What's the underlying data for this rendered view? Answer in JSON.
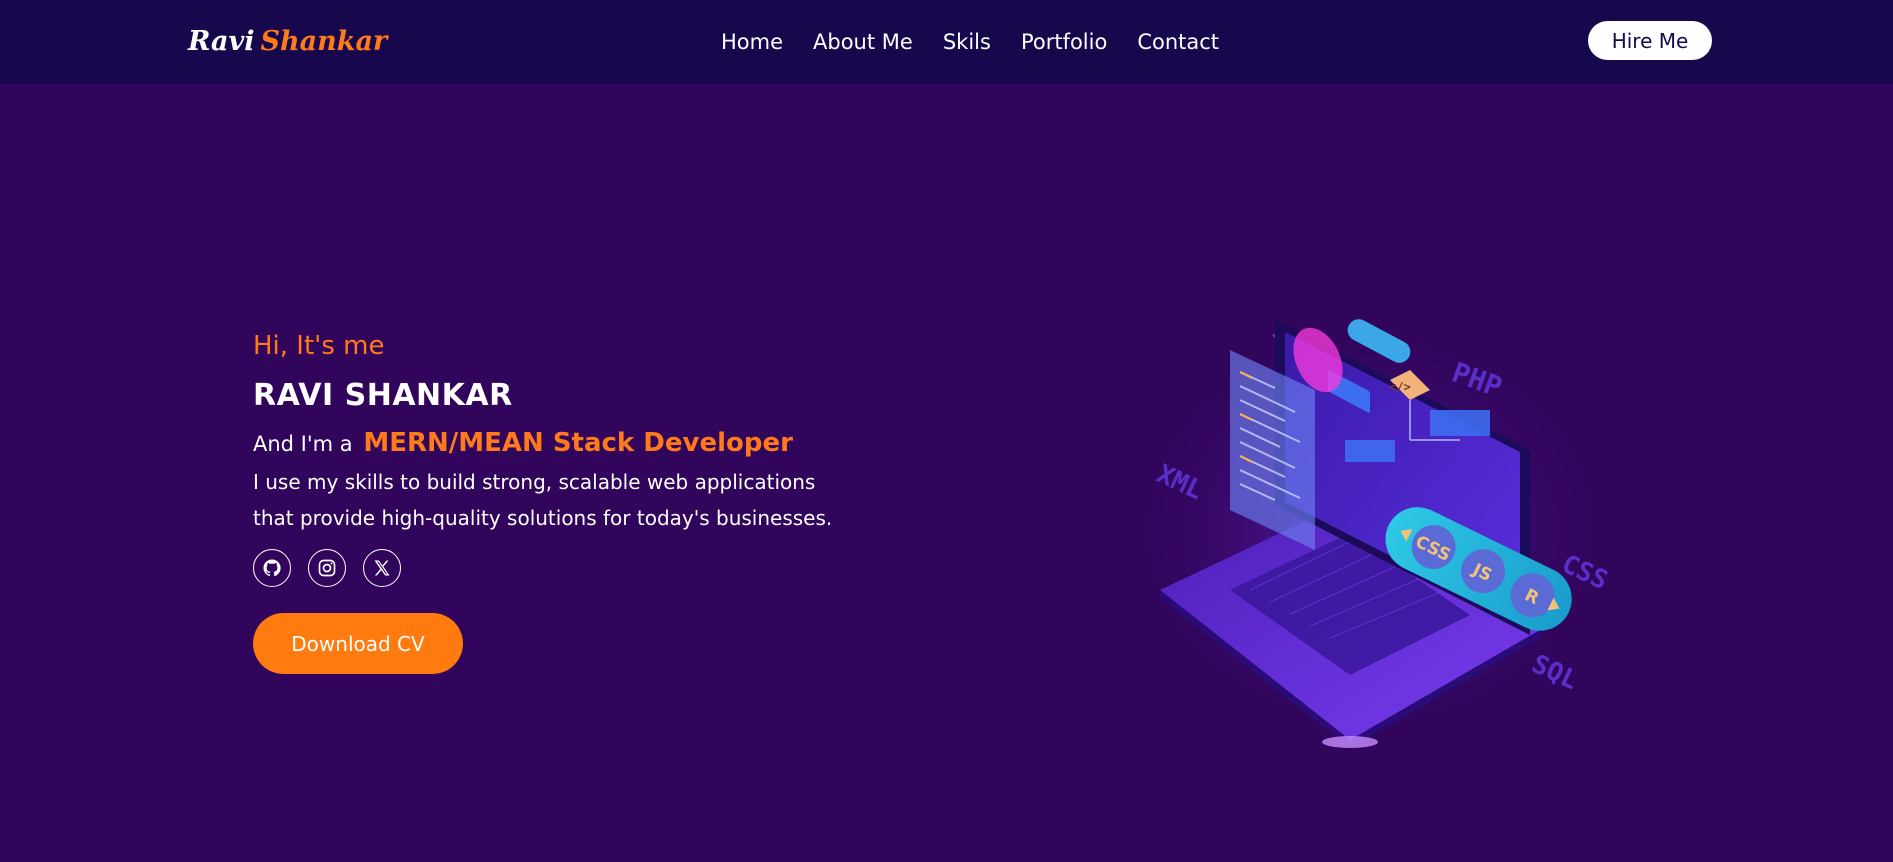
{
  "logo": {
    "first": "Ravi",
    "last": "Shankar"
  },
  "nav": {
    "links": [
      {
        "label": "Home"
      },
      {
        "label": "About Me"
      },
      {
        "label": "Skils"
      },
      {
        "label": "Portfolio"
      },
      {
        "label": "Contact"
      }
    ],
    "hire_label": "Hire Me"
  },
  "hero": {
    "greeting": "Hi, It's me",
    "name": "RAVI SHANKAR",
    "role_prefix": "And I'm a",
    "role": "MERN/MEAN Stack Developer",
    "bio": "I use my skills to build strong, scalable web applications that provide high-quality solutions for today's businesses.",
    "socials": [
      {
        "icon": "github-icon"
      },
      {
        "icon": "instagram-icon"
      },
      {
        "icon": "x-twitter-icon"
      }
    ],
    "cv_label": "Download CV"
  },
  "illustration": {
    "badges": [
      "CSS",
      "JS",
      "R"
    ],
    "floating_labels": [
      "PHP",
      "XML",
      "CSS",
      "SQL",
      "</>"
    ],
    "code_glyph": "</>"
  },
  "colors": {
    "nav_bg": "#17084d",
    "page_bg": "#31055b",
    "accent": "#ff7a1a",
    "text": "#ffffff"
  }
}
